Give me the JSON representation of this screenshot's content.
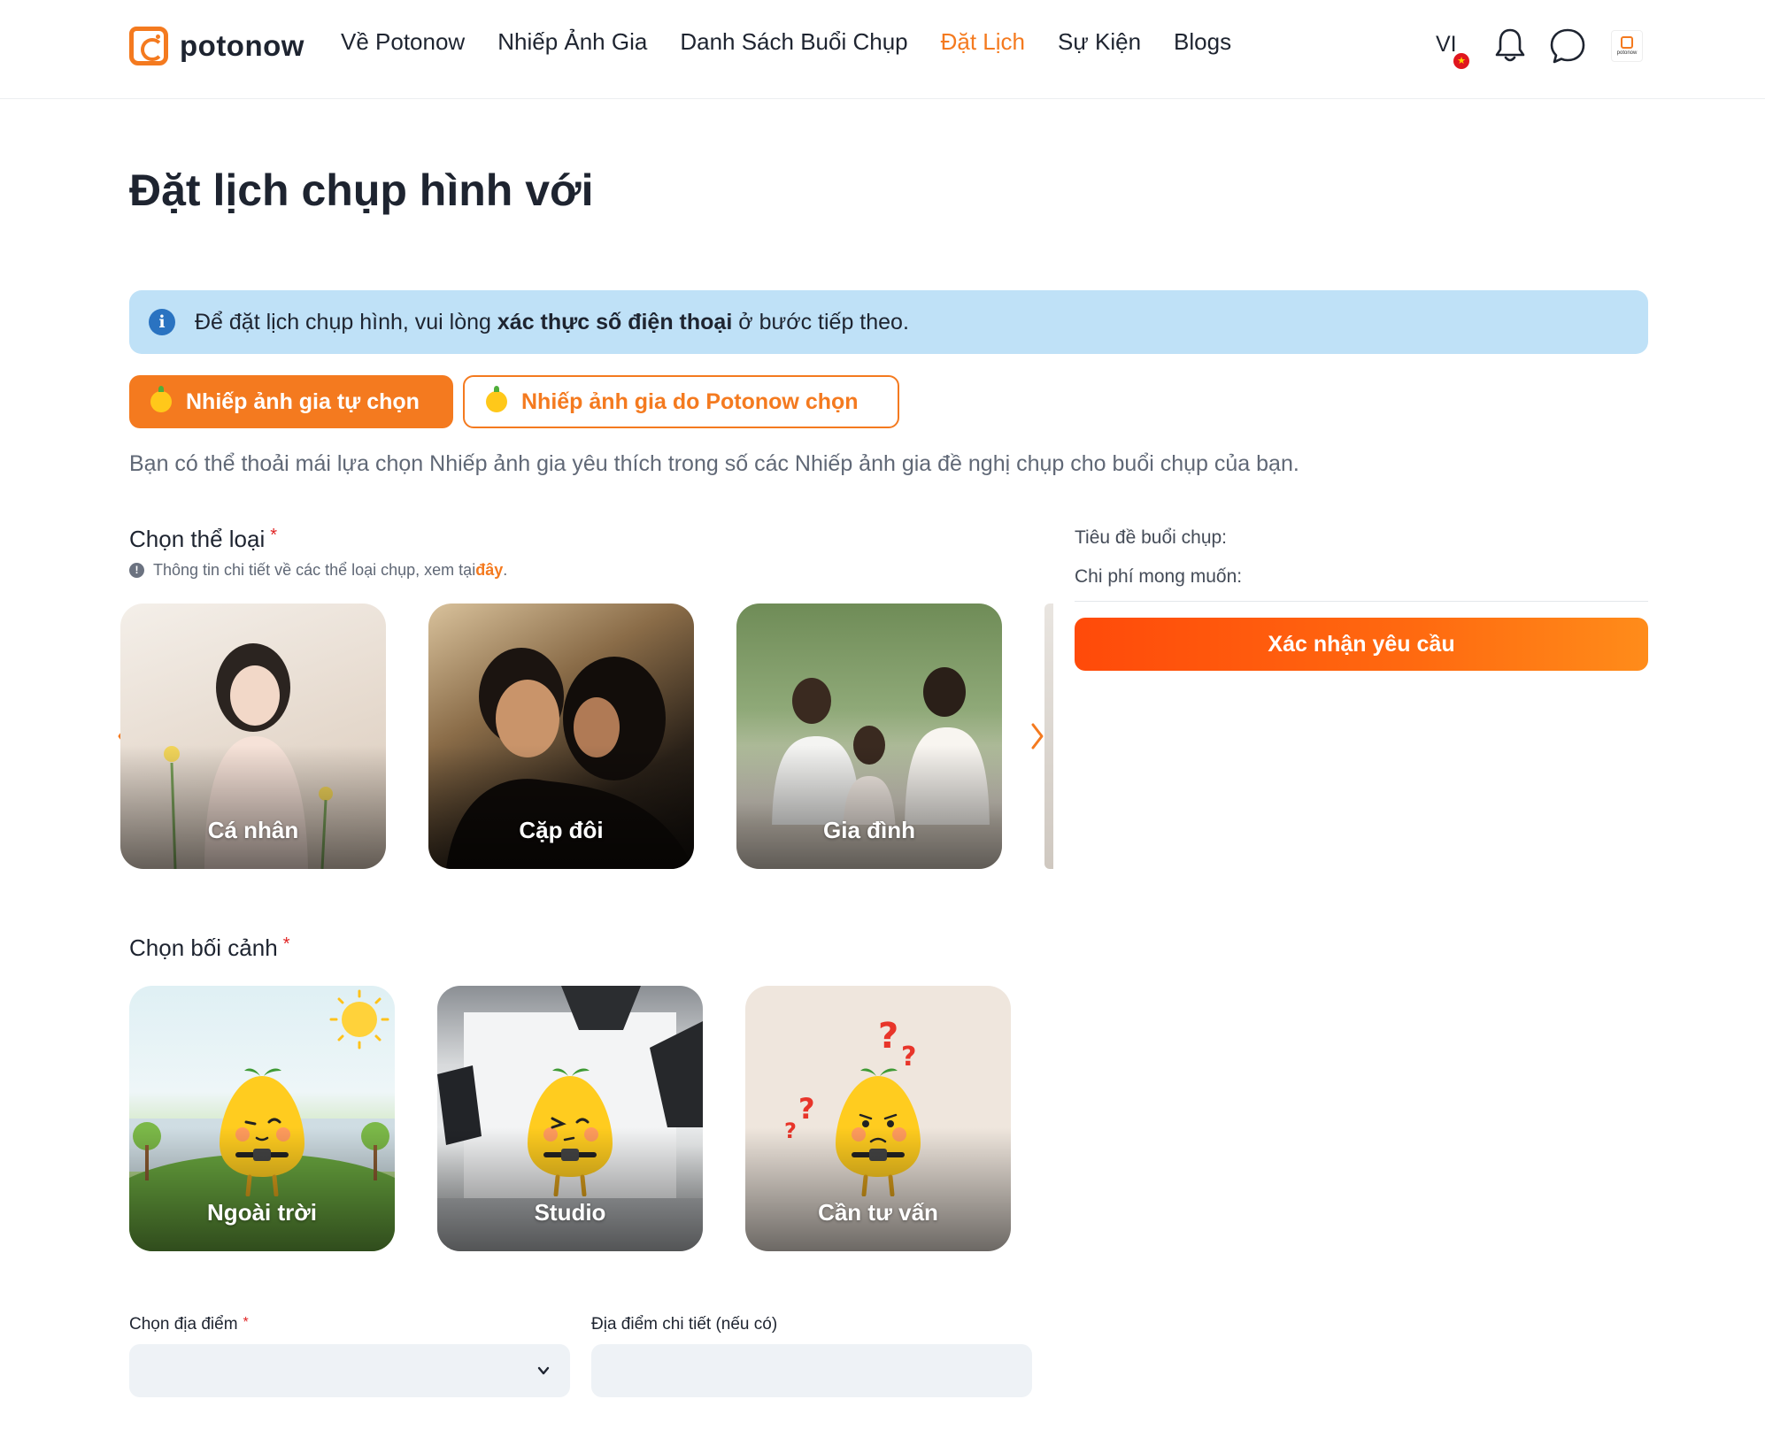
{
  "header": {
    "logo_text": "potonow",
    "nav": [
      {
        "label": "Về Potonow",
        "active": false
      },
      {
        "label": "Nhiếp Ảnh Gia",
        "active": false
      },
      {
        "label": "Danh Sách Buổi Chụp",
        "active": false
      },
      {
        "label": "Đặt Lịch",
        "active": true
      },
      {
        "label": "Sự Kiện",
        "active": false
      },
      {
        "label": "Blogs",
        "active": false
      }
    ],
    "language": "VI",
    "icons": [
      "bell-icon",
      "chat-icon",
      "avatar"
    ],
    "avatar_text": "potonow"
  },
  "main": {
    "title": "Đặt lịch chụp hình với",
    "info_banner": {
      "prefix": "Để đặt lịch chụp hình, vui lòng ",
      "bold": "xác thực số điện thoại",
      "suffix": " ở bước tiếp theo."
    },
    "mode_buttons": {
      "self_select": "Nhiếp ảnh gia tự chọn",
      "potonow_select": "Nhiếp ảnh gia do Potonow chọn"
    },
    "mode_description": "Bạn có thể thoải mái lựa chọn Nhiếp ảnh gia yêu thích trong số các Nhiếp ảnh gia đề nghị chụp cho buổi chụp của bạn.",
    "category": {
      "label": "Chọn thể loại",
      "required_mark": "*",
      "hint_prefix": "Thông tin chi tiết về các thể loại chụp, xem tại ",
      "hint_link": "đây",
      "hint_suffix": ".",
      "items": [
        "Cá nhân",
        "Cặp đôi",
        "Gia đình"
      ]
    },
    "scene": {
      "label": "Chọn bối cảnh",
      "required_mark": "*",
      "items": [
        "Ngoài trời",
        "Studio",
        "Cần tư vấn"
      ]
    },
    "location": {
      "label": "Chọn địa điểm",
      "required_mark": "*",
      "value": ""
    },
    "location_detail": {
      "label": "Địa điểm chi tiết (nếu có)",
      "value": ""
    }
  },
  "summary": {
    "title_label": "Tiêu đề buổi chụp:",
    "cost_label": "Chi phí mong muốn:",
    "confirm_button": "Xác nhận yêu cầu"
  },
  "colors": {
    "accent": "#f47a1f",
    "info_bg": "#bfe1f7",
    "info_icon": "#2a73c1",
    "required": "#e02424",
    "field_bg": "#eef2f6"
  }
}
